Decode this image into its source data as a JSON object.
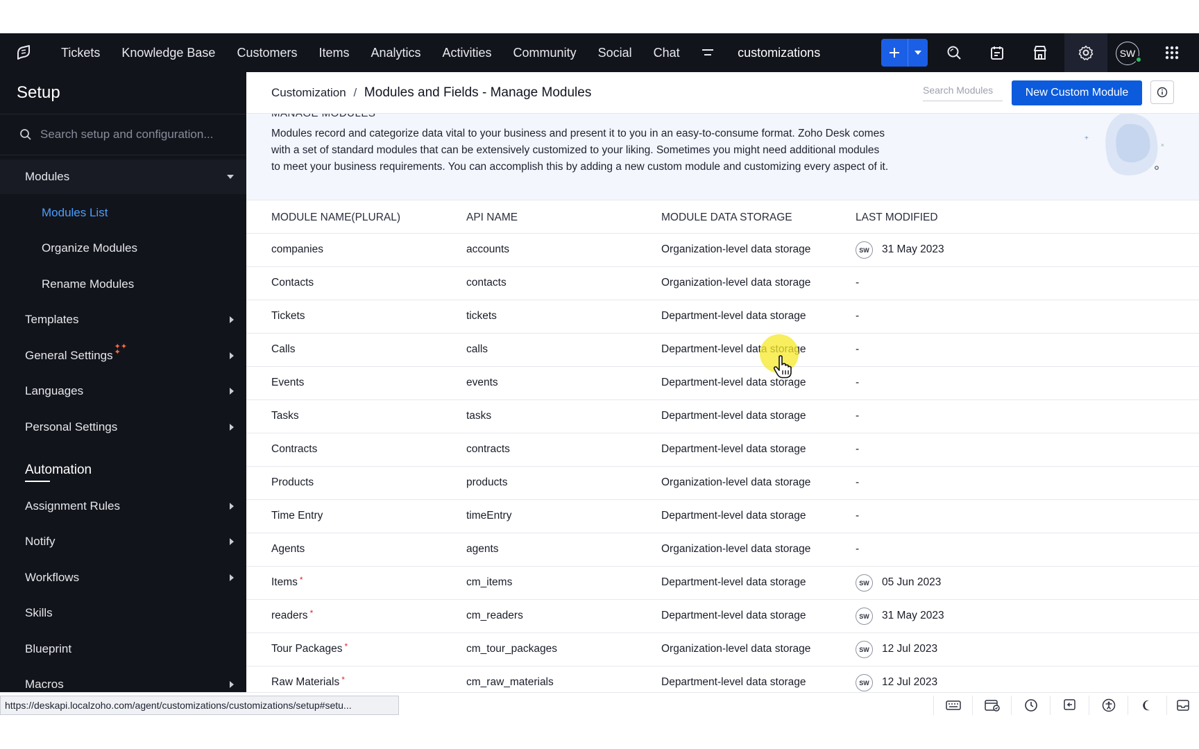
{
  "topnav": {
    "tabs": [
      "Tickets",
      "Knowledge Base",
      "Customers",
      "Items",
      "Analytics",
      "Activities",
      "Community",
      "Social",
      "Chat"
    ],
    "department": "customizations",
    "avatar": "SW"
  },
  "sidebar": {
    "title": "Setup",
    "search_placeholder": "Search setup and configuration...",
    "modules_label": "Modules",
    "modules_sub": [
      "Modules List",
      "Organize Modules",
      "Rename Modules"
    ],
    "templates": "Templates",
    "general_settings": "General Settings",
    "languages": "Languages",
    "personal_settings": "Personal Settings",
    "automation_heading": "Automation",
    "automation_items": [
      "Assignment Rules",
      "Notify",
      "Workflows",
      "Skills",
      "Blueprint",
      "Macros"
    ]
  },
  "header": {
    "breadcrumb_parent": "Customization",
    "breadcrumb_sep": "/",
    "breadcrumb_current": "Modules and Fields - Manage Modules",
    "search_placeholder": "Search Modules",
    "new_button": "New Custom Module"
  },
  "banner": {
    "title": "MANAGE MODULES",
    "text": "Modules record and categorize data vital to your business and present it to you in an easy-to-consume format. Zoho Desk comes with a set of standard modules that can be extensively customized to your liking. Sometimes you might need additional modules to meet your business requirements. You can accomplish this by adding a new custom module and customizing every aspect of it."
  },
  "table": {
    "columns": [
      "MODULE NAME(PLURAL)",
      "API NAME",
      "MODULE DATA STORAGE",
      "LAST MODIFIED"
    ],
    "rows": [
      {
        "name": "companies",
        "api": "accounts",
        "storage": "Organization-level data storage",
        "modified": "31 May 2023",
        "by": "SW"
      },
      {
        "name": "Contacts",
        "api": "contacts",
        "storage": "Organization-level data storage",
        "modified": "-"
      },
      {
        "name": "Tickets",
        "api": "tickets",
        "storage": "Department-level data storage",
        "modified": "-"
      },
      {
        "name": "Calls",
        "api": "calls",
        "storage": "Department-level data storage",
        "modified": "-"
      },
      {
        "name": "Events",
        "api": "events",
        "storage": "Department-level data storage",
        "modified": "-"
      },
      {
        "name": "Tasks",
        "api": "tasks",
        "storage": "Department-level data storage",
        "modified": "-"
      },
      {
        "name": "Contracts",
        "api": "contracts",
        "storage": "Department-level data storage",
        "modified": "-"
      },
      {
        "name": "Products",
        "api": "products",
        "storage": "Organization-level data storage",
        "modified": "-"
      },
      {
        "name": "Time Entry",
        "api": "timeEntry",
        "storage": "Department-level data storage",
        "modified": "-"
      },
      {
        "name": "Agents",
        "api": "agents",
        "storage": "Organization-level data storage",
        "modified": "-"
      },
      {
        "name": "Items",
        "api": "cm_items",
        "storage": "Department-level data storage",
        "modified": "05 Jun 2023",
        "by": "SW",
        "required": "*"
      },
      {
        "name": "readers",
        "api": "cm_readers",
        "storage": "Department-level data storage",
        "modified": "31 May 2023",
        "by": "SW",
        "required": "*"
      },
      {
        "name": "Tour Packages",
        "api": "cm_tour_packages",
        "storage": "Organization-level data storage",
        "modified": "12 Jul 2023",
        "by": "SW",
        "required": "*"
      },
      {
        "name": "Raw Materials",
        "api": "cm_raw_materials",
        "storage": "Department-level data storage",
        "modified": "12 Jul 2023",
        "by": "SW",
        "required": "*"
      }
    ]
  },
  "statusbar": {
    "url": "https://deskapi.localzoho.com/agent/customizations/customizations/setup#setu..."
  },
  "colors": {
    "nav_bg": "#12141b",
    "accent": "#0b5bdc",
    "active_link": "#4c9dff",
    "required": "#e0242a"
  }
}
